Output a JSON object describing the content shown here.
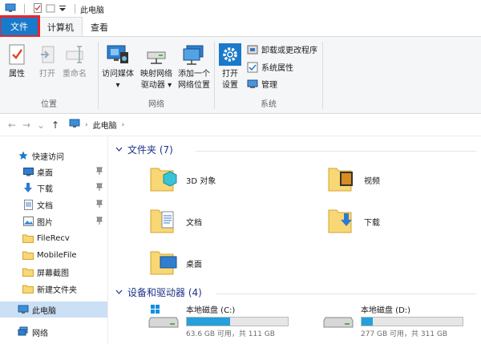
{
  "titlebar": {
    "title": "此电脑",
    "icons": [
      "computer-icon",
      "properties-icon",
      "new-folder-icon",
      "customize-dropdown-icon"
    ]
  },
  "tabs": {
    "file": "文件",
    "computer": "计算机",
    "view": "查看"
  },
  "ribbon": {
    "location": {
      "label": "位置",
      "properties": "属性",
      "open": "打开",
      "rename": "重命名"
    },
    "network": {
      "label": "网络",
      "media_line1": "访问媒体",
      "media_arrow": "▾",
      "map_line1": "映射网络",
      "map_line2": "驱动器",
      "map_arrow": "▾",
      "addloc_line1": "添加一个",
      "addloc_line2": "网络位置"
    },
    "system": {
      "label": "系统",
      "settings_line1": "打开",
      "settings_line2": "设置",
      "uninstall": "卸载或更改程序",
      "sysprops": "系统属性",
      "manage": "管理"
    }
  },
  "address": {
    "back": "←",
    "forward": "→",
    "recent": "⌄",
    "up": "↑",
    "crumb": "此电脑",
    "chevron": "›"
  },
  "nav": {
    "quick_access": "快速访问",
    "items": [
      {
        "label": "桌面",
        "pinned": true
      },
      {
        "label": "下载",
        "pinned": true
      },
      {
        "label": "文档",
        "pinned": true
      },
      {
        "label": "图片",
        "pinned": true
      },
      {
        "label": "FileRecv",
        "pinned": false
      },
      {
        "label": "MobileFile",
        "pinned": false
      },
      {
        "label": "屏幕截图",
        "pinned": false
      },
      {
        "label": "新建文件夹",
        "pinned": false
      }
    ],
    "this_pc": "此电脑",
    "network": "网络",
    "pin_glyph": "📌"
  },
  "content": {
    "folders_header": "文件夹 (7)",
    "folders": [
      {
        "name": "3D 对象",
        "icon": "3d-objects-folder-icon"
      },
      {
        "name": "视频",
        "icon": "videos-folder-icon"
      },
      {
        "name": "文档",
        "icon": "documents-folder-icon"
      },
      {
        "name": "下载",
        "icon": "downloads-folder-icon"
      },
      {
        "name": "桌面",
        "icon": "desktop-folder-icon"
      }
    ],
    "drives_header": "设备和驱动器 (4)",
    "drives": [
      {
        "name": "本地磁盘 (C:)",
        "detail": "63.6 GB 可用，共 111 GB",
        "used_fraction": 0.43
      },
      {
        "name": "本地磁盘 (D:)",
        "detail": "277 GB 可用，共 311 GB",
        "used_fraction": 0.11
      }
    ]
  },
  "colors": {
    "accent": "#1979ca",
    "highlight": "#e8262b",
    "header_blue": "#1e3287",
    "drive_bar": "#26a0da",
    "folder_yellow": "#f8d775",
    "selected": "#cce0f5"
  }
}
